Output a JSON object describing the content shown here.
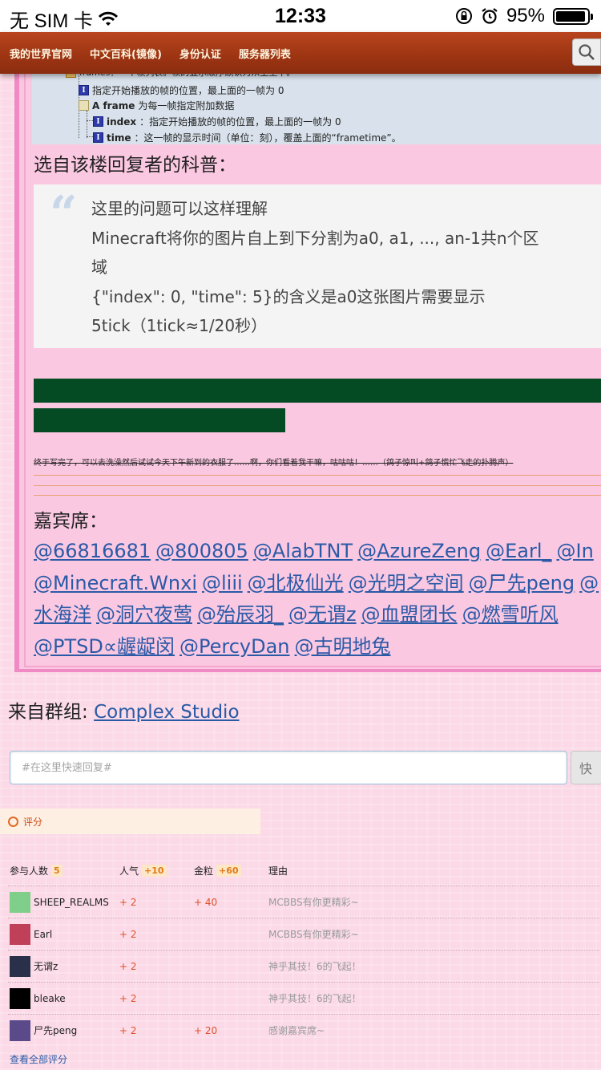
{
  "status_bar": {
    "carrier": "无 SIM 卡",
    "time": "12:33",
    "battery_percent": "95%",
    "battery_level": 0.95
  },
  "nav": {
    "items": [
      "我的世界官网",
      "中文百科(镜像)",
      "身份认证",
      "服务器列表"
    ]
  },
  "tree": {
    "frames_line": "frames：一个帧列表。帧的显示顺序默认为从上至下。",
    "index_line": "指定开始播放的帧的位置，最上面的一帧为 0",
    "frame_label": "A frame",
    "frame_desc": "为每一帧指定附加数据",
    "sub_index_label": "index",
    "sub_index_desc": "：指定开始播放的帧的位置，最上面的一帧为 0",
    "sub_time_label": "time",
    "sub_time_desc": "：这一帧的显示时间（单位：刻），覆盖上面的“frametime”。"
  },
  "post": {
    "quote_heading": "选自该楼回复者的科普：",
    "quote_lines": [
      "这里的问题可以这样理解",
      "Minecraft将你的图片自上到下分割为a0, a1, ..., an-1共n个区",
      "域",
      "{\"index\": 0, \"time\": 5}的含义是a0这张图片需要显示",
      "5tick（1tick≈1/20秒）"
    ],
    "strike_note": "终于写完了，可以去洗澡然后试试今天下午新到的衣服了……啊，你们看着我干嘛，咕咕咕！……（鸽子惊叫+鸽子慌忙飞走的扑腾声）",
    "guest_heading": "嘉宾席：",
    "guest_lines": [
      [
        "@66816681",
        "@800805",
        "@AlabTNT",
        "@AzureZeng",
        "@Earl_",
        "@In"
      ],
      [
        "@Minecraft.Wnxi",
        "@liii",
        "@北极仙光",
        "@光明之空间",
        "@尸先peng",
        "@"
      ],
      [
        "水海洋",
        "@洞穴夜莺",
        "@殆辰羽_",
        "@无谓z",
        "@血盟团长",
        "@燃雪听风"
      ],
      [
        "@PTSD∝龌龊闵",
        "@PercyDan",
        "@古明地兔"
      ]
    ]
  },
  "group": {
    "label": "来自群组: ",
    "name": "Complex Studio"
  },
  "reply": {
    "placeholder": "#在这里快速回复#",
    "button_label": "快"
  },
  "rating": {
    "title": "评分",
    "headers": {
      "participants": "参与人数",
      "participants_count": "5",
      "popularity": "人气",
      "popularity_total": "+10",
      "gold": "金粒",
      "gold_total": "+60",
      "reason": "理由"
    },
    "rows": [
      {
        "user": "SHEEP_REALMS",
        "popularity": "+ 2",
        "gold": "+ 40",
        "reason": "MCBBS有你更精彩~",
        "avatar_color": "#7fcf8a"
      },
      {
        "user": "Earl",
        "popularity": "+ 2",
        "gold": "",
        "reason": "MCBBS有你更精彩~",
        "avatar_color": "#c0405a"
      },
      {
        "user": "无谓z",
        "popularity": "+ 2",
        "gold": "",
        "reason": "神乎其技！6的飞起！",
        "avatar_color": "#2a2f4a"
      },
      {
        "user": "bleake",
        "popularity": "+ 2",
        "gold": "",
        "reason": "神乎其技！6的飞起！",
        "avatar_color": "#000000"
      },
      {
        "user": "尸先peng",
        "popularity": "+ 2",
        "gold": "+ 20",
        "reason": "感谢嘉宾席~",
        "avatar_color": "#5a4a8a"
      }
    ],
    "view_all": "查看全部评分"
  },
  "colors": {
    "nav_bg": "#9c3412",
    "link": "#2a5aa6",
    "green_bar": "#044b24",
    "post_bg": "#fbc8e2",
    "accent_plus": "#e0502a"
  }
}
